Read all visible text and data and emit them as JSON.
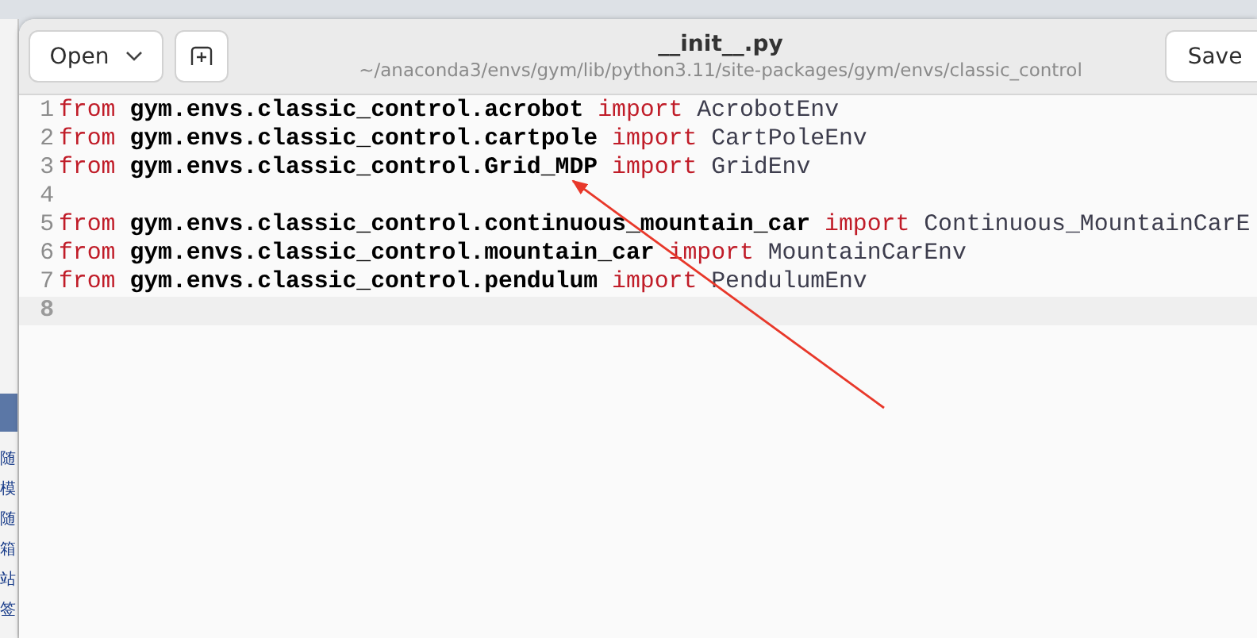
{
  "background_window": {
    "items": [
      "随",
      "模",
      "随",
      "箱",
      "站",
      "签"
    ]
  },
  "window": {
    "open_button": "Open",
    "title": "__init__.py",
    "path": "~/anaconda3/envs/gym/lib/python3.11/site-packages/gym/envs/classic_control",
    "save_button": "Save"
  },
  "editor": {
    "lines": [
      {
        "number": "1",
        "current": false,
        "tokens": [
          {
            "kind": "keyword",
            "text": "from"
          },
          {
            "kind": "module",
            "text": "gym.envs.classic_control.acrobot"
          },
          {
            "kind": "keyword",
            "text": "import"
          },
          {
            "kind": "name",
            "text": "AcrobotEnv"
          }
        ]
      },
      {
        "number": "2",
        "current": false,
        "tokens": [
          {
            "kind": "keyword",
            "text": "from"
          },
          {
            "kind": "module",
            "text": "gym.envs.classic_control.cartpole"
          },
          {
            "kind": "keyword",
            "text": "import"
          },
          {
            "kind": "name",
            "text": "CartPoleEnv"
          }
        ]
      },
      {
        "number": "3",
        "current": false,
        "tokens": [
          {
            "kind": "keyword",
            "text": "from"
          },
          {
            "kind": "module",
            "text": "gym.envs.classic_control.Grid_MDP"
          },
          {
            "kind": "keyword",
            "text": "import"
          },
          {
            "kind": "name",
            "text": "GridEnv"
          }
        ]
      },
      {
        "number": "4",
        "current": false
      },
      {
        "number": "5",
        "current": false,
        "tokens": [
          {
            "kind": "keyword",
            "text": "from"
          },
          {
            "kind": "module",
            "text": "gym.envs.classic_control.continuous_mountain_car"
          },
          {
            "kind": "keyword",
            "text": "import"
          },
          {
            "kind": "name",
            "text": "Continuous_MountainCarE"
          }
        ]
      },
      {
        "number": "6",
        "current": false,
        "tokens": [
          {
            "kind": "keyword",
            "text": "from"
          },
          {
            "kind": "module",
            "text": "gym.envs.classic_control.mountain_car"
          },
          {
            "kind": "keyword",
            "text": "import"
          },
          {
            "kind": "name",
            "text": "MountainCarEnv"
          }
        ]
      },
      {
        "number": "7",
        "current": false,
        "tokens": [
          {
            "kind": "keyword",
            "text": "from"
          },
          {
            "kind": "module",
            "text": "gym.envs.classic_control.pendulum"
          },
          {
            "kind": "keyword",
            "text": "import"
          },
          {
            "kind": "name",
            "text": "PendulumEnv"
          }
        ]
      },
      {
        "number": "8",
        "current": true
      }
    ]
  }
}
